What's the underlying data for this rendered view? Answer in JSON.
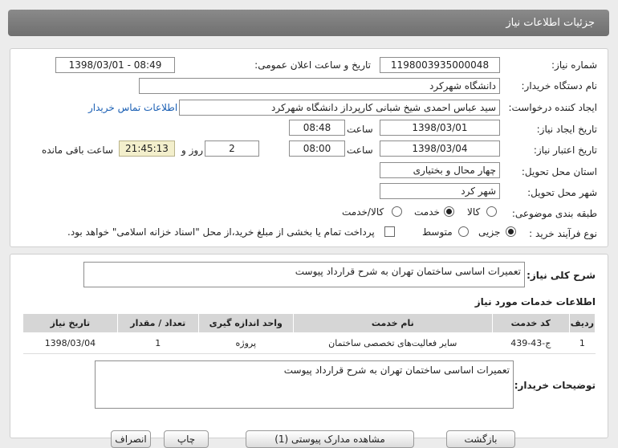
{
  "header": {
    "title": "جزئیات اطلاعات نیاز"
  },
  "form": {
    "need_number_label": "شماره نیاز:",
    "need_number": "1198003935000048",
    "announce_label": "تاریخ و ساعت اعلان عمومی:",
    "announce_value": "1398/03/01 - 08:49",
    "buyer_org_label": "نام دستگاه خریدار:",
    "buyer_org": "دانشگاه شهرکرد",
    "creator_label": "ایجاد کننده درخواست:",
    "creator": "سید عباس احمدی شیخ شبانی کارپرداز دانشگاه شهرکرد",
    "contact_link": "اطلاعات تماس خریدار",
    "created_date_label": "تاریخ ایجاد نیاز:",
    "created_date": "1398/03/01",
    "time_label": "ساعت",
    "created_time": "08:48",
    "validity_label": "تاریخ اعتبار نیاز:",
    "validity_date": "1398/03/04",
    "validity_time": "08:00",
    "days": "2",
    "days_and_label": "روز و",
    "remaining_time": "21:45:13",
    "remaining_label": "ساعت باقی مانده",
    "province_label": "استان محل تحویل:",
    "province": "چهار محال و بختیاری",
    "city_label": "شهر محل تحویل:",
    "city": "شهر کرد",
    "category_label": "طبقه بندی موضوعی:",
    "category_options": [
      "کالا",
      "خدمت",
      "کالا/خدمت"
    ],
    "process_label": "نوع فرآیند خرید :",
    "process_options": [
      "جزیی",
      "متوسط"
    ],
    "payment_note": "پرداخت تمام یا بخشی از مبلغ خرید،از محل \"اسناد خزانه اسلامی\" خواهد بود."
  },
  "summary": {
    "label": "شرح کلی نیاز:",
    "text": "تعمیرات اساسی ساختمان تهران  به شرح قرارداد پیوست"
  },
  "services": {
    "title": "اطلاعات خدمات مورد نیاز",
    "columns": [
      "ردیف",
      "کد خدمت",
      "نام خدمت",
      "واحد اندازه گیری",
      "تعداد / مقدار",
      "تاریخ نیاز"
    ],
    "rows": [
      [
        "1",
        "ج-43-439",
        "سایر فعالیت‌های تخصصی ساختمان",
        "پروژه",
        "1",
        "1398/03/04"
      ]
    ]
  },
  "buyer_notes": {
    "label": "توضیحات خریدار:",
    "text": "تعمیرات اساسی ساختمان تهران  به شرح قرارداد پیوست"
  },
  "buttons": {
    "b1": "بازگشت",
    "b2": "مشاهده مدارک پیوستی (1)",
    "b3": "چاپ",
    "b4": "انصراف"
  }
}
